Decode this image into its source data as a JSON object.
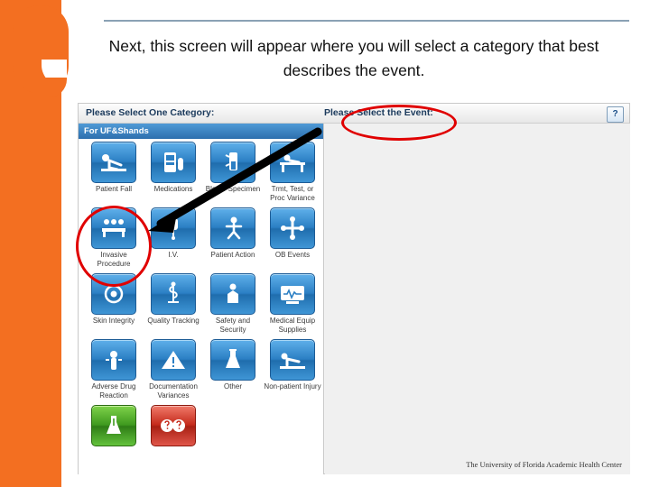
{
  "slide": {
    "title": "Next, this screen will appear where you will select a category that best describes the event.",
    "accent_color": "#f36f21",
    "rule_color": "#8aa1b5",
    "annotation_color": "#e00000"
  },
  "app": {
    "header": {
      "category_label": "Please Select One Category:",
      "event_label": "Please Select the Event:",
      "help_button": "?"
    },
    "category_pane": {
      "subheader": "For UF&Shands",
      "tiles": [
        {
          "label": "Patient Fall",
          "icon": "patient-fall-icon"
        },
        {
          "label": "Medications",
          "icon": "medications-icon"
        },
        {
          "label": "Blood/ Specimen",
          "icon": "blood-specimen-icon"
        },
        {
          "label": "Trmt, Test, or Proc Variance",
          "icon": "treatment-test-icon"
        },
        {
          "label": "Invasive Procedure",
          "icon": "invasive-procedure-icon"
        },
        {
          "label": "I.V.",
          "icon": "iv-icon"
        },
        {
          "label": "Patient Action",
          "icon": "patient-action-icon"
        },
        {
          "label": "OB Events",
          "icon": "ob-events-icon"
        },
        {
          "label": "Skin Integrity",
          "icon": "skin-integrity-icon"
        },
        {
          "label": "Quality Tracking",
          "icon": "quality-tracking-icon"
        },
        {
          "label": "Safety and Security",
          "icon": "safety-security-icon"
        },
        {
          "label": "Medical Equip Supplies",
          "icon": "medical-equipment-icon"
        },
        {
          "label": "Adverse Drug Reaction",
          "icon": "adverse-drug-reaction-icon"
        },
        {
          "label": "Documentation Variances",
          "icon": "documentation-variances-icon"
        },
        {
          "label": "Other",
          "icon": "other-icon"
        },
        {
          "label": "Non-patient Injury",
          "icon": "non-patient-injury-icon"
        },
        {
          "label": "",
          "icon": "lab-flask-icon"
        },
        {
          "label": "",
          "icon": "question-faces-icon"
        }
      ]
    },
    "footer_credit": "The University of Florida Academic Health Center"
  }
}
